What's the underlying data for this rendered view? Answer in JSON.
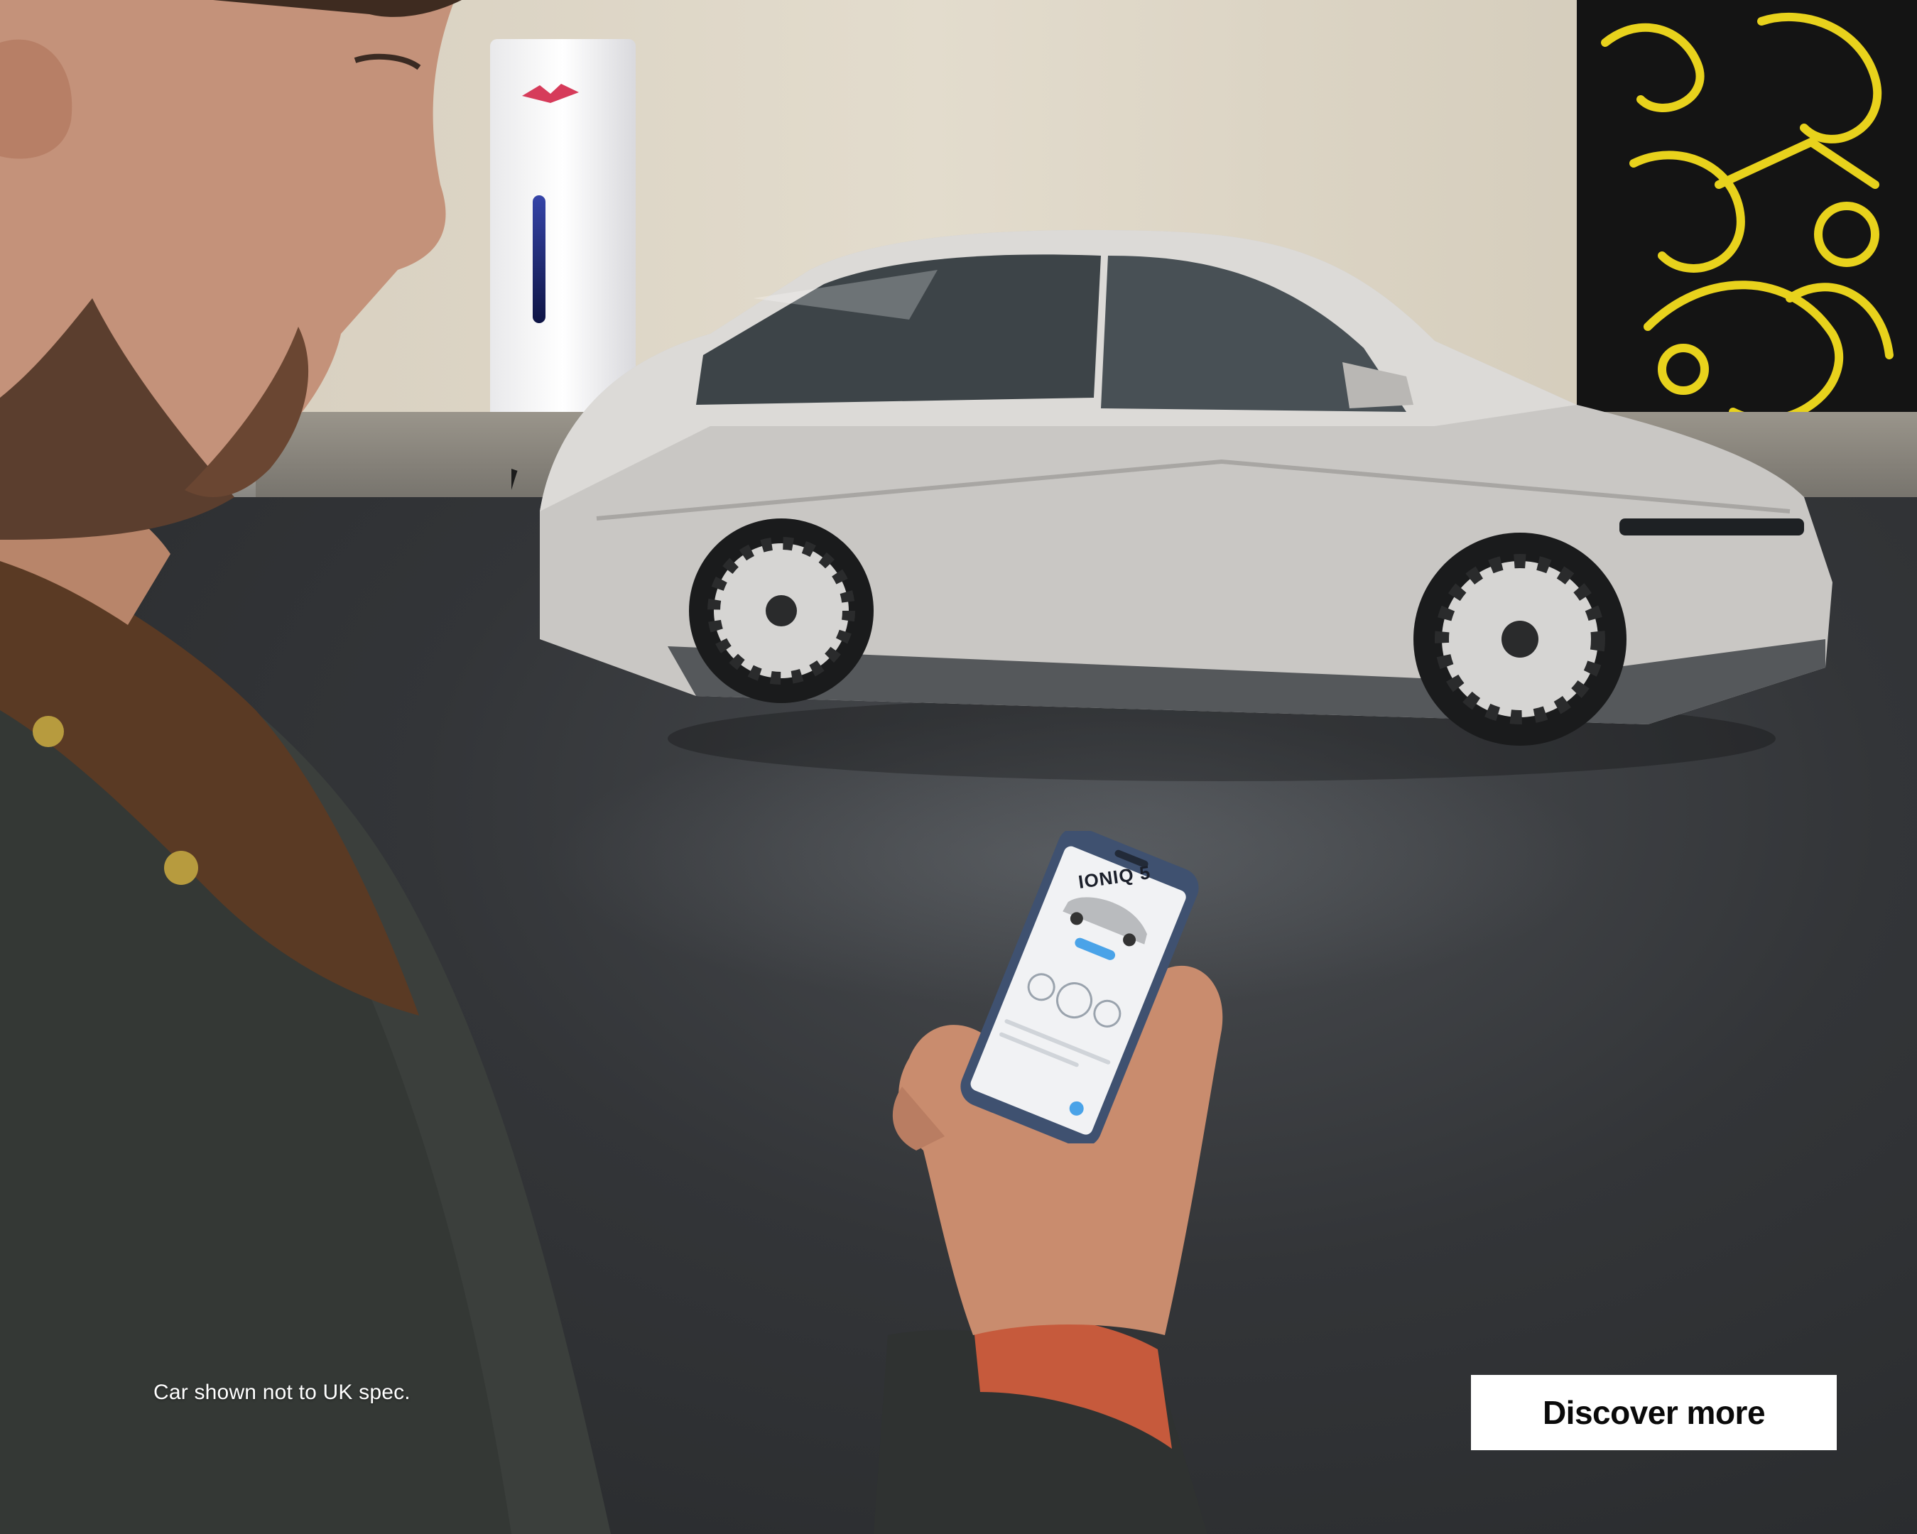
{
  "hero": {
    "image_label": "",
    "phone_screen_brand": "IONIQ 5",
    "disclaimer": "Car shown not to UK spec.",
    "cta_label": "Discover more"
  },
  "colors": {
    "cta_background": "#ffffff",
    "cta_text": "#0a0a0a",
    "disclaimer_text": "#ffffff",
    "mural_accent": "#e8d21c",
    "car_body": "#c9c7c4"
  }
}
